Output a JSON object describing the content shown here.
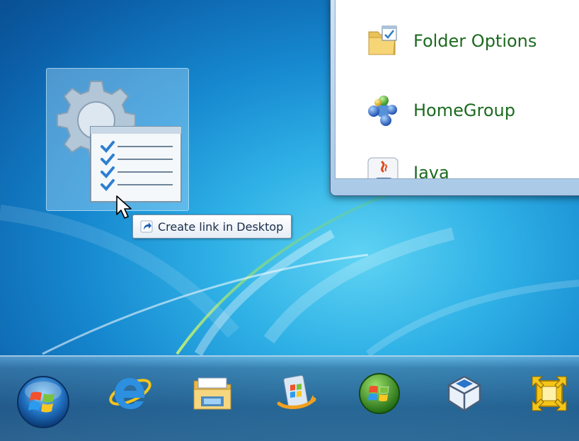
{
  "tooltip": {
    "label": "Create link in Desktop",
    "icon": "shortcut-arrow-icon"
  },
  "drag_item": {
    "icon": "task-settings-icon"
  },
  "control_panel": {
    "items": [
      {
        "label": "Folder Options",
        "icon": "folder-options-icon"
      },
      {
        "label": "HomeGroup",
        "icon": "homegroup-icon"
      },
      {
        "label": "Java",
        "icon": "java-icon"
      }
    ]
  },
  "taskbar": {
    "start_icon": "windows-logo-icon",
    "pinned": [
      {
        "name": "internet-explorer",
        "icon": "internet-explorer-icon"
      },
      {
        "name": "windows-explorer",
        "icon": "folder-icon"
      },
      {
        "name": "windows-update",
        "icon": "windows-update-icon"
      },
      {
        "name": "windows-media-center",
        "icon": "media-center-icon"
      },
      {
        "name": "virtualbox",
        "icon": "virtualbox-icon"
      },
      {
        "name": "resize-tool",
        "icon": "resize-arrows-icon"
      }
    ]
  },
  "colors": {
    "cp_label": "#1c6a1f",
    "tooltip_text": "#1c2d4a",
    "wallpaper_center": "#5fd3f3",
    "wallpaper_edge": "#0a4f92"
  }
}
